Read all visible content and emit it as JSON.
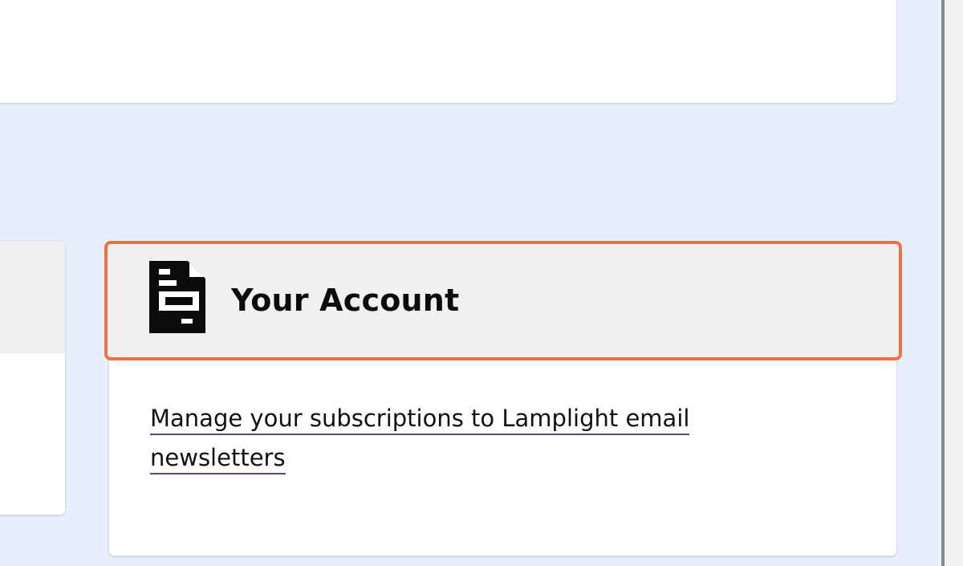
{
  "colors": {
    "page_background": "#e8effc",
    "card_background": "#ffffff",
    "header_background": "#f0f0f0",
    "focus_outline": "#f27141",
    "link_underline": "#5b4a7a"
  },
  "account_card": {
    "icon": "document-icon",
    "title": "Your Account",
    "link_text": "Manage your subscriptions to Lamplight email newsletters"
  }
}
